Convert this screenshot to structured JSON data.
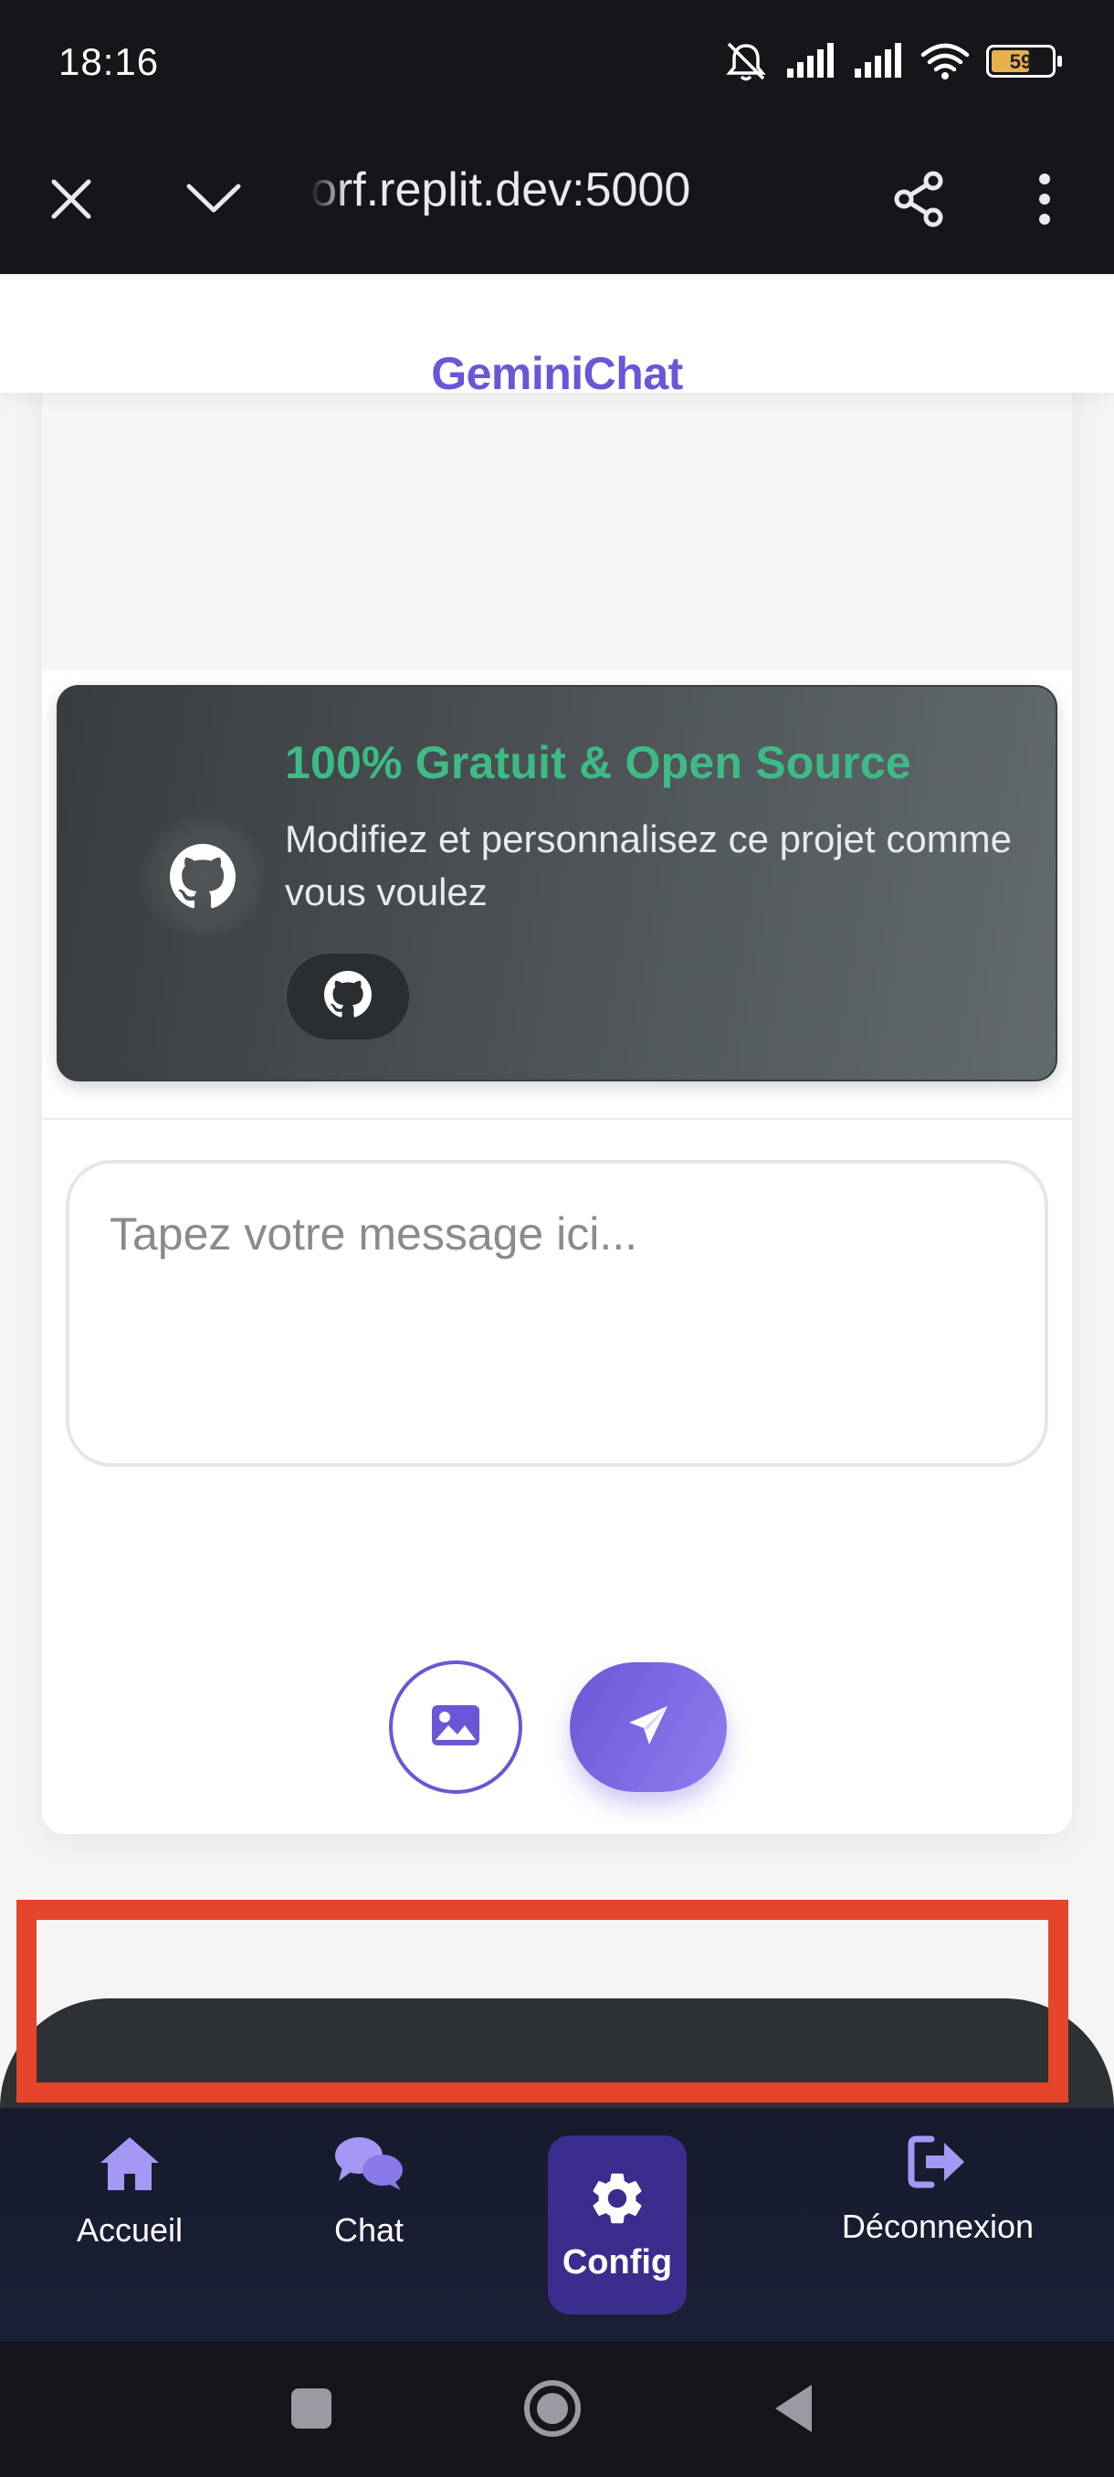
{
  "status_bar": {
    "time": "18:16",
    "battery_level": "59",
    "icons": [
      "bell-off-icon",
      "signal-icon",
      "signal-icon",
      "wifi-icon",
      "battery-icon"
    ]
  },
  "browser": {
    "url": "orf.replit.dev:5000",
    "icons": [
      "close-icon",
      "chevron-down-icon",
      "share-icon",
      "more-vert-icon"
    ]
  },
  "app": {
    "title": "GeminiChat"
  },
  "promo": {
    "title": "100% Gratuit & Open Source",
    "description": "Modifiez et personnalisez ce projet comme vous voulez",
    "icons": [
      "github-icon",
      "github-icon"
    ]
  },
  "composer": {
    "placeholder": "Tapez votre message ici...",
    "icons": [
      "image-icon",
      "send-icon"
    ]
  },
  "nav": {
    "items": [
      {
        "label": "Accueil",
        "icon": "home-icon"
      },
      {
        "label": "Chat",
        "icon": "chat-icon"
      },
      {
        "label": "Config",
        "icon": "gear-icon",
        "active": true
      },
      {
        "label": "Déconnexion",
        "icon": "logout-icon"
      }
    ]
  },
  "colors": {
    "accent": "#6a56d6",
    "promo_title": "#3dbb85",
    "highlight": "#e5452a",
    "nav_background": "#161a2c",
    "nav_active": "#3a2d8e"
  }
}
